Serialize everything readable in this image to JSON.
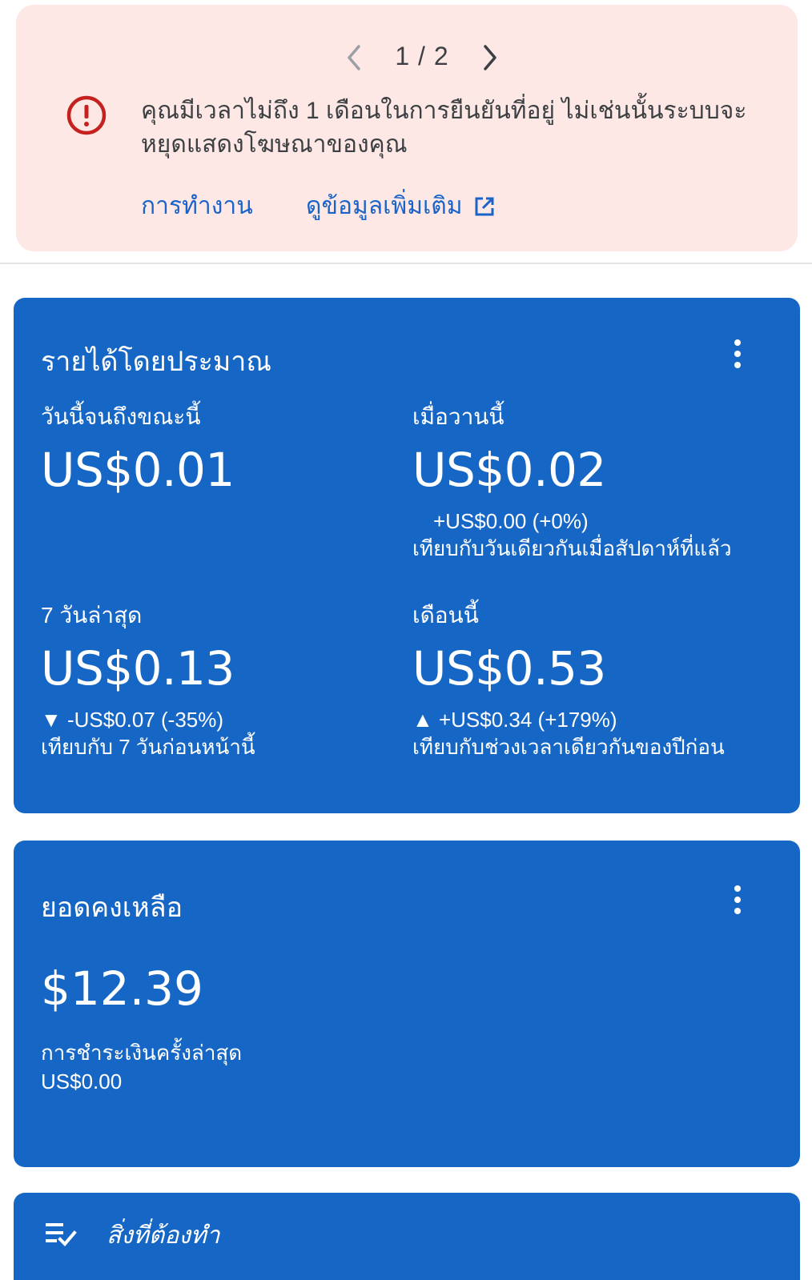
{
  "alert": {
    "pager": "1 / 2",
    "message": "คุณมีเวลาไม่ถึง 1 เดือนในการยืนยันที่อยู่ ไม่เช่นนั้นระบบจะหยุดแสดงโฆษณาของคุณ",
    "action_label": "การทำงาน",
    "learn_more_label": "ดูข้อมูลเพิ่มเติม",
    "icon": "error-icon"
  },
  "earnings": {
    "title": "รายได้โดยประมาณ",
    "today": {
      "label": "วันนี้จนถึงขณะนี้",
      "value": "US$0.01"
    },
    "yesterday": {
      "label": "เมื่อวานนี้",
      "value": "US$0.02",
      "change": "+US$0.00 (+0%)",
      "compare": "เทียบกับวันเดียวกันเมื่อสัปดาห์ที่แล้ว"
    },
    "last7": {
      "label": "7 วันล่าสุด",
      "value": "US$0.13",
      "change": "▼ -US$0.07 (-35%)",
      "compare": "เทียบกับ 7 วันก่อนหน้านี้"
    },
    "month": {
      "label": "เดือนนี้",
      "value": "US$0.53",
      "change": "▲ +US$0.34 (+179%)",
      "compare": "เทียบกับช่วงเวลาเดียวกันของปีก่อน"
    }
  },
  "balance": {
    "title": "ยอดคงเหลือ",
    "value": "$12.39",
    "last_payment_label": "การชำระเงินครั้งล่าสุด",
    "last_payment_value": "US$0.00"
  },
  "todo": {
    "title": "สิ่งที่ต้องทำ",
    "icon": "checklist-icon"
  },
  "colors": {
    "card_blue": "#1667c5",
    "alert_bg": "#fde8e6",
    "error_red": "#c5221f",
    "link_blue": "#1a63c9"
  }
}
